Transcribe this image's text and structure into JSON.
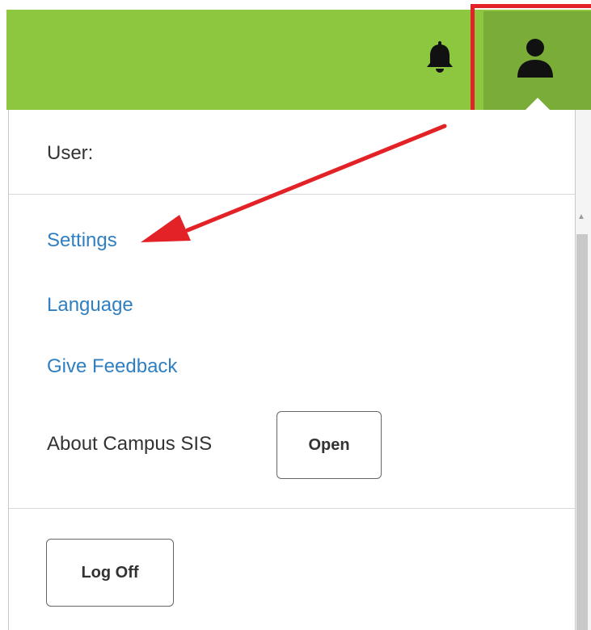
{
  "header": {
    "accent_color": "#8dc63f",
    "icons": [
      "bell-icon",
      "person-icon"
    ]
  },
  "menu": {
    "user_label": "User:",
    "links": [
      "Settings",
      "Language",
      "Give Feedback"
    ],
    "about_label": "About Campus SIS",
    "open_button": "Open",
    "logoff_button": "Log Off"
  },
  "annotations": {
    "highlight_color": "#e32227"
  }
}
